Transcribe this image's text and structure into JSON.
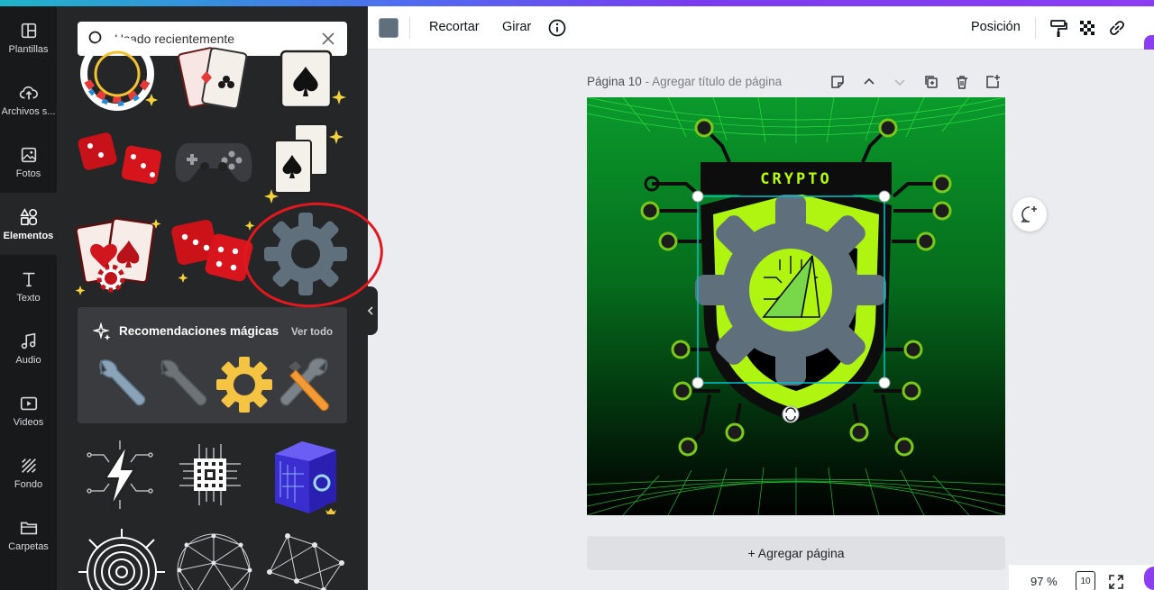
{
  "rail": {
    "items": [
      {
        "label": "Plantillas"
      },
      {
        "label": "Archivos s..."
      },
      {
        "label": "Fotos"
      },
      {
        "label": "Elementos"
      },
      {
        "label": "Texto"
      },
      {
        "label": "Audio"
      },
      {
        "label": "Videos"
      },
      {
        "label": "Fondo"
      },
      {
        "label": "Carpetas"
      }
    ]
  },
  "search": {
    "value": "Usado recientemente"
  },
  "magic": {
    "title": "Recomendaciones mágicas",
    "see_all": "Ver todo"
  },
  "toolbar": {
    "crop": "Recortar",
    "flip": "Girar",
    "position": "Posición",
    "color": "#5f6f7c"
  },
  "page": {
    "number_label": "Página 10",
    "title_placeholder": " - Agregar título de página"
  },
  "design": {
    "title": "CRYPTO"
  },
  "add_page": "+ Agregar página",
  "zoom": "97 %",
  "page_count": "10",
  "colors": {
    "accent": "#8b3df2",
    "design_green": "#0b9a2c",
    "lime": "#b6ff00",
    "gear_gray": "#5f6f7c",
    "selection": "#00c4cc",
    "highlight_circle": "#e0191f"
  }
}
